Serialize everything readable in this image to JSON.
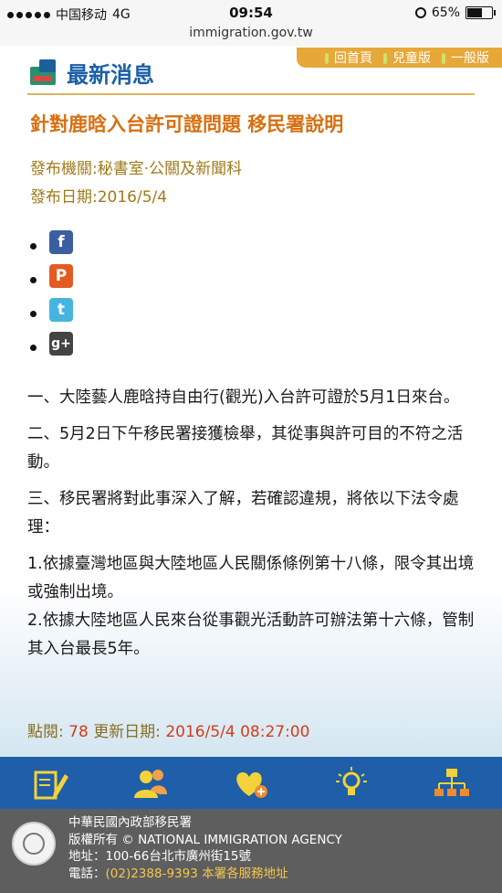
{
  "status_bar": {
    "carrier": "中国移动",
    "network": "4G",
    "time": "09:54",
    "battery": "65%",
    "battery_level": 0.65
  },
  "url_bar": {
    "url": "immigration.gov.tw"
  },
  "top_links": [
    {
      "label": "回首頁"
    },
    {
      "label": "兒童版"
    },
    {
      "label": "一般版"
    }
  ],
  "section": {
    "title": "最新消息",
    "icon": "news-icon"
  },
  "article": {
    "title": "針對鹿晗入台許可證問題 移民署說明",
    "publisher": "發布機關:秘書室·公關及新聞科",
    "date": "發布日期:2016/5/4",
    "paragraphs": [
      "一、大陸藝人鹿晗持自由行(觀光)入台許可證於5月1日來台。",
      "二、5月2日下午移民署接獲檢舉，其從事與許可目的不符之活動。",
      "三、移民署將對此事深入了解，若確認違規，將依以下法令處理：",
      "1.依據臺灣地區與大陸地區人民關係條例第十八條，限令其出境或強制出境。",
      "2.依據大陸地區人民來台從事觀光活動許可辦法第十六條，管制其入台最長5年。"
    ]
  },
  "share": [
    {
      "icon": "facebook-icon",
      "glyph": "f"
    },
    {
      "icon": "plurk-icon",
      "glyph": "P"
    },
    {
      "icon": "twitter-icon",
      "glyph": "t"
    },
    {
      "icon": "google-plus-icon",
      "glyph": "g+"
    }
  ],
  "stats": {
    "views_label": "點閱:",
    "views": "78",
    "updated_label": "更新日期:",
    "updated": "2016/5/4 08:27:00"
  },
  "bottom_nav": [
    {
      "icon": "pencil-document-icon"
    },
    {
      "icon": "people-icon"
    },
    {
      "icon": "heart-plus-icon"
    },
    {
      "icon": "lightbulb-icon"
    },
    {
      "icon": "sitemap-icon"
    }
  ],
  "footer": {
    "org": "中華民國內政部移民署",
    "copyright": "版權所有 © NATIONAL IMMIGRATION AGENCY",
    "address": "地址：100-66台北市廣州街15號",
    "phone_label": "電話：",
    "phone": "(02)2388-9393",
    "service_link": "本署各服務地址"
  },
  "colors": {
    "brand_blue": "#1f5ea8",
    "accent_orange": "#d86f10",
    "meta_gold": "#a07a1a",
    "top_links_bg": "#e7a83a",
    "footer_bg": "#5e5e5e"
  }
}
